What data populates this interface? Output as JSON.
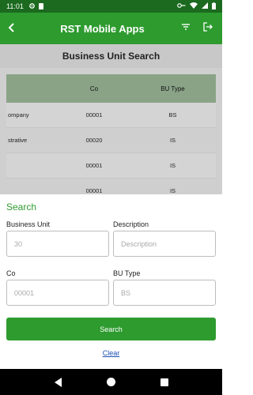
{
  "status_bar": {
    "time": "11:01"
  },
  "app_bar": {
    "title": "RST Mobile Apps"
  },
  "page": {
    "title": "Business Unit Search",
    "table": {
      "headers": [
        "",
        "Co",
        "BU Type"
      ],
      "rows": [
        {
          "name": "ompany",
          "co": "00001",
          "type": "BS"
        },
        {
          "name": "strative",
          "co": "00020",
          "type": "IS"
        },
        {
          "name": "",
          "co": "00001",
          "type": "IS"
        },
        {
          "name": "",
          "co": "00001",
          "type": "IS"
        }
      ]
    }
  },
  "search": {
    "title": "Search",
    "business_unit": {
      "label": "Business Unit",
      "placeholder": "30"
    },
    "description": {
      "label": "Description",
      "placeholder": "Description"
    },
    "co": {
      "label": "Co",
      "placeholder": "00001"
    },
    "bu_type": {
      "label": "BU Type",
      "placeholder": "BS"
    },
    "search_button": "Search",
    "clear_link": "Clear"
  },
  "colors": {
    "primary": "#2e9b2f",
    "status_bar": "#1b6a1f",
    "link": "#1b4fb0"
  }
}
